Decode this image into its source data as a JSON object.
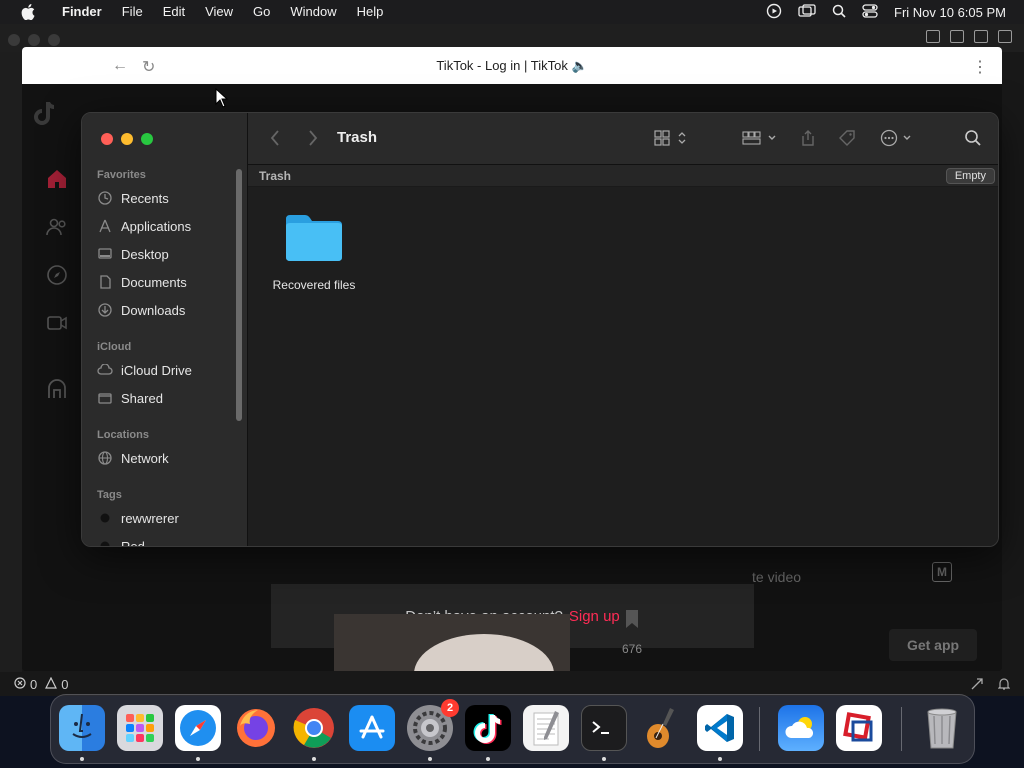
{
  "menubar": {
    "app_name": "Finder",
    "items": [
      "File",
      "Edit",
      "View",
      "Go",
      "Window",
      "Help"
    ],
    "clock": "Fri Nov 10  6:05 PM"
  },
  "editor": {
    "status_errors": "0",
    "status_warnings": "0"
  },
  "chrome": {
    "tab_title": "TikTok - Log in | TikTok 🔈"
  },
  "tiktok": {
    "login_prompt": "Don’t have an account?",
    "signup_link": "Sign up",
    "like_count": "676",
    "get_app": "Get app",
    "video_label_fragment": "te video",
    "m_icon_letter": "M"
  },
  "finder": {
    "title": "Trash",
    "path_label": "Trash",
    "empty_button": "Empty",
    "sidebar": {
      "favorites_header": "Favorites",
      "favorites": [
        "Recents",
        "Applications",
        "Desktop",
        "Documents",
        "Downloads"
      ],
      "icloud_header": "iCloud",
      "icloud": [
        "iCloud Drive",
        "Shared"
      ],
      "locations_header": "Locations",
      "locations": [
        "Network"
      ],
      "tags_header": "Tags",
      "tags": [
        "rewwrerer",
        "Red"
      ]
    },
    "items": [
      {
        "name": "Recovered files",
        "icon": "folder-icon",
        "color": "#3fb4f0"
      }
    ]
  },
  "dock": {
    "apps": [
      "Finder",
      "Launchpad",
      "Safari",
      "Firefox",
      "Chrome",
      "App Store",
      "System Settings",
      "TikTok",
      "TextEdit",
      "Terminal",
      "GarageBand",
      "VS Code",
      "Weather",
      "Parallels",
      "Trash"
    ],
    "settings_badge": "2"
  }
}
